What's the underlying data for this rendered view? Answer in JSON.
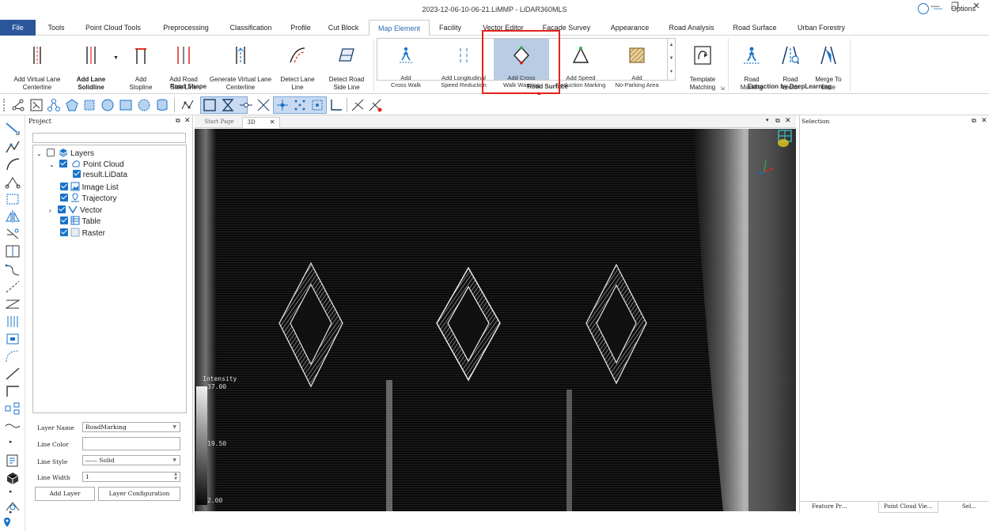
{
  "window": {
    "title": "2023-12-06-10-06-21.LiMMP - LiDAR360MLS",
    "options_label": "Options",
    "controls": {
      "minimize": "—",
      "maximize": "❐",
      "close": "✕"
    }
  },
  "tabs": [
    {
      "label": "File"
    },
    {
      "label": "Tools"
    },
    {
      "label": "Point Cloud Tools"
    },
    {
      "label": "Preprocessing"
    },
    {
      "label": "Classification"
    },
    {
      "label": "Profile"
    },
    {
      "label": "Cut Block"
    },
    {
      "label": "Map Element"
    },
    {
      "label": "Facility"
    },
    {
      "label": "Vector Editor"
    },
    {
      "label": "Facade Survey"
    },
    {
      "label": "Appearance"
    },
    {
      "label": "Road Analysis"
    },
    {
      "label": "Road Surface"
    },
    {
      "label": "Urban Forestry"
    }
  ],
  "ribbon": {
    "road_shape": {
      "label": "Road Shape",
      "buttons": [
        {
          "label": "Add Virtual Lane\nCenterline"
        },
        {
          "label": "Add Lane\nSolidline"
        },
        {
          "label": "Add\nStopline"
        },
        {
          "label": "Add Road\nSide Line"
        },
        {
          "label": "Generate Virtual Lane\nCenterline"
        },
        {
          "label": "Detect Lane\nLine"
        },
        {
          "label": "Detect Road\nSide Line"
        }
      ]
    },
    "road_surface": {
      "label": "Road Surface",
      "items": [
        {
          "label": "Add\nCross Walk"
        },
        {
          "label": "Add Longitudinal\nSpeed Reduction"
        },
        {
          "label": "Add Cross\nWalk Warning"
        },
        {
          "label": "Add Speed\nReduction Marking"
        },
        {
          "label": "Add\nNo-Parking Area"
        }
      ],
      "template_matching": "Template\nMatching"
    },
    "deep_learning": {
      "label": "Extraction by DeepLearning",
      "buttons": [
        {
          "label": "Road\nMarking"
        },
        {
          "label": "Road\nVector"
        },
        {
          "label": "Merge To\nLane"
        }
      ]
    }
  },
  "project": {
    "header": "Project",
    "tree": [
      {
        "label": "Layers",
        "checked": false
      },
      {
        "label": "Point Cloud",
        "checked": true
      },
      {
        "label": "result.LiData",
        "checked": true
      },
      {
        "label": "Image List",
        "checked": true
      },
      {
        "label": "Trajectory",
        "checked": true
      },
      {
        "label": "Vector",
        "checked": true
      },
      {
        "label": "Table",
        "checked": true
      },
      {
        "label": "Raster",
        "checked": true
      }
    ],
    "props": {
      "layer_name_label": "Layer Name",
      "layer_name_value": "RoadMarking",
      "line_color_label": "Line Color",
      "line_style_label": "Line Style",
      "line_style_value": "—— Solid",
      "line_width_label": "Line Width",
      "line_width_value": "1",
      "add_layer": "Add Layer",
      "layer_config": "Layer Configuration"
    }
  },
  "view": {
    "tabs": [
      {
        "label": "Start Page"
      },
      {
        "label": "3D"
      }
    ],
    "tab_close": "✕",
    "intensity": {
      "label": "Intensity",
      "max": "37.00",
      "mid": "19.50",
      "min": "2.00"
    }
  },
  "selection": {
    "header": "Selection",
    "tabs": [
      {
        "label": "Feature Pr…"
      },
      {
        "label": "Point Cloud Vie…"
      },
      {
        "label": "Sel…"
      }
    ]
  },
  "colors": {
    "accent": "#2b579a",
    "highlight": "#b8cce4",
    "annotation": "#e2231a",
    "checkbox": "#1a73c9"
  }
}
